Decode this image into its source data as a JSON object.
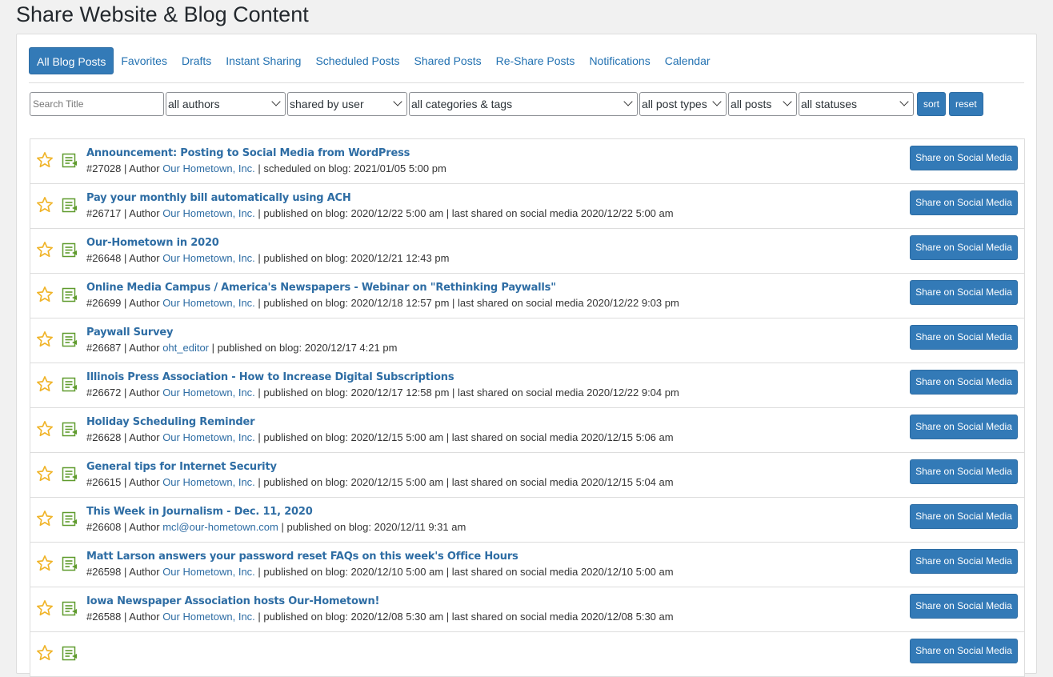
{
  "page": {
    "title": "Share Website & Blog Content"
  },
  "tabs": [
    {
      "label": "All Blog Posts",
      "active": true
    },
    {
      "label": "Favorites"
    },
    {
      "label": "Drafts"
    },
    {
      "label": "Instant Sharing"
    },
    {
      "label": "Scheduled Posts"
    },
    {
      "label": "Shared Posts"
    },
    {
      "label": "Re-Share Posts"
    },
    {
      "label": "Notifications"
    },
    {
      "label": "Calendar"
    }
  ],
  "filters": {
    "search_placeholder": "Search Title",
    "authors": "all authors",
    "shared_by": "shared by user",
    "categories": "all categories & tags",
    "post_types": "all post types",
    "posts": "all posts",
    "statuses": "all statuses",
    "sort_label": "sort",
    "reset_label": "reset"
  },
  "colors": {
    "accent": "#337ab7",
    "star": "#f0b429",
    "doc_icon": "#5f9b2d"
  },
  "share_label": "Share on Social Media",
  "posts": [
    {
      "title": "Announcement: Posting to Social Media from WordPress",
      "id": "#27028",
      "author": "Our Hometown, Inc.",
      "status": "scheduled on blog: 2021/01/05 5:00 pm",
      "last_shared": ""
    },
    {
      "title": "Pay your monthly bill automatically using ACH",
      "id": "#26717",
      "author": "Our Hometown, Inc.",
      "status": "published on blog: 2020/12/22 5:00 am",
      "last_shared": "last shared on social media 2020/12/22 5:00 am"
    },
    {
      "title": "Our-Hometown in 2020",
      "id": "#26648",
      "author": "Our Hometown, Inc.",
      "status": "published on blog: 2020/12/21 12:43 pm",
      "last_shared": ""
    },
    {
      "title": "Online Media Campus / America's Newspapers - Webinar on \"Rethinking Paywalls\"",
      "id": "#26699",
      "author": "Our Hometown, Inc.",
      "status": "published on blog: 2020/12/18 12:57 pm",
      "last_shared": "last shared on social media 2020/12/22 9:03 pm"
    },
    {
      "title": "Paywall Survey",
      "id": "#26687",
      "author": "oht_editor",
      "status": "published on blog: 2020/12/17 4:21 pm",
      "last_shared": ""
    },
    {
      "title": "Illinois Press Association - How to Increase Digital Subscriptions",
      "id": "#26672",
      "author": "Our Hometown, Inc.",
      "status": "published on blog: 2020/12/17 12:58 pm",
      "last_shared": "last shared on social media 2020/12/22 9:04 pm"
    },
    {
      "title": "Holiday Scheduling Reminder",
      "id": "#26628",
      "author": "Our Hometown, Inc.",
      "status": "published on blog: 2020/12/15 5:00 am",
      "last_shared": "last shared on social media 2020/12/15 5:06 am"
    },
    {
      "title": "General tips for Internet Security",
      "id": "#26615",
      "author": "Our Hometown, Inc.",
      "status": "published on blog: 2020/12/15 5:00 am",
      "last_shared": "last shared on social media 2020/12/15 5:04 am"
    },
    {
      "title": "This Week in Journalism - Dec. 11, 2020",
      "id": "#26608",
      "author": "mcl@our-hometown.com",
      "status": "published on blog: 2020/12/11 9:31 am",
      "last_shared": ""
    },
    {
      "title": "Matt Larson answers your password reset FAQs on this week's Office Hours",
      "id": "#26598",
      "author": "Our Hometown, Inc.",
      "status": "published on blog: 2020/12/10 5:00 am",
      "last_shared": "last shared on social media 2020/12/10 5:00 am"
    },
    {
      "title": "Iowa Newspaper Association hosts Our-Hometown!",
      "id": "#26588",
      "author": "Our Hometown, Inc.",
      "status": "published on blog: 2020/12/08 5:30 am",
      "last_shared": "last shared on social media 2020/12/08 5:30 am"
    },
    {
      "title": "",
      "id": "",
      "author": "",
      "status": "",
      "last_shared": ""
    }
  ]
}
